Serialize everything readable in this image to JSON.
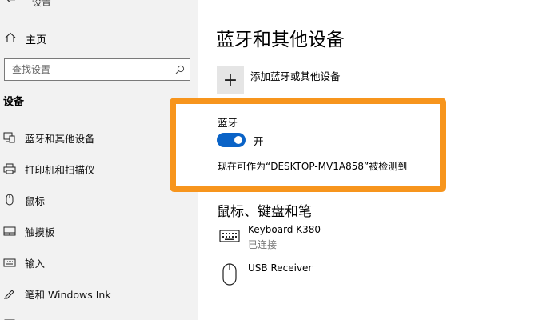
{
  "window": {
    "title": "设置"
  },
  "sidebar": {
    "home_label": "主页",
    "search_placeholder": "查找设置",
    "section": "设备",
    "items": [
      {
        "label": "蓝牙和其他设备",
        "icon": "bluetooth-devices-icon"
      },
      {
        "label": "打印机和扫描仪",
        "icon": "printer-icon"
      },
      {
        "label": "鼠标",
        "icon": "mouse-icon"
      },
      {
        "label": "触摸板",
        "icon": "touchpad-icon"
      },
      {
        "label": "输入",
        "icon": "keyboard-icon"
      },
      {
        "label": "笔和 Windows Ink",
        "icon": "pen-icon"
      }
    ]
  },
  "main": {
    "title": "蓝牙和其他设备",
    "add_device_label": "添加蓝牙或其他设备",
    "bluetooth": {
      "label": "蓝牙",
      "toggle_state": "开",
      "is_on": true,
      "discoverable_text": "现在可作为“DESKTOP-MV1A858”被检测到"
    },
    "mouse_section_title": "鼠标、键盘和笔",
    "devices": [
      {
        "name": "Keyboard K380",
        "status": "已连接",
        "icon": "keyboard-icon"
      },
      {
        "name": "USB Receiver",
        "status": "",
        "icon": "mouse-icon"
      }
    ]
  },
  "colors": {
    "accent": "#0a63c7",
    "highlight": "#f7951d"
  }
}
